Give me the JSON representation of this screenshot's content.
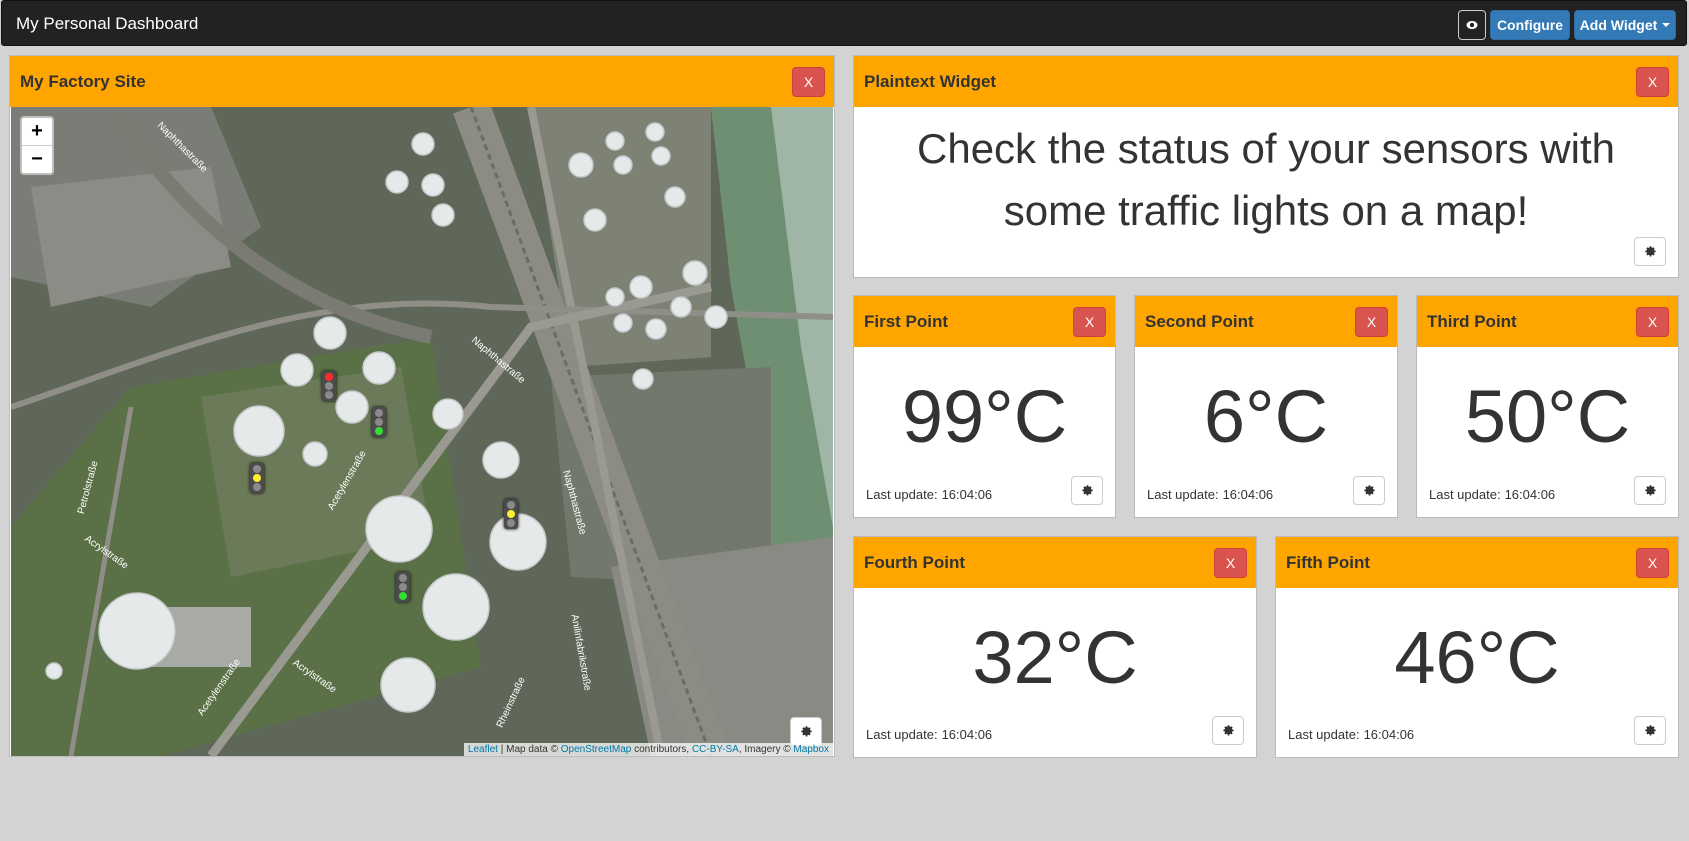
{
  "navbar": {
    "brand": "My Personal Dashboard",
    "configure_label": "Configure",
    "add_widget_label": "Add Widget"
  },
  "close_label": "X",
  "last_update_label": "Last update:",
  "map_widget": {
    "title": "My Factory Site",
    "zoom_in": "+",
    "zoom_out": "−",
    "attribution": {
      "leaflet": "Leaflet",
      "sep1": " | Map data © ",
      "osm": "OpenStreetMap",
      "sep2": " contributors, ",
      "license": "CC-BY-SA",
      "sep3": ", Imagery © ",
      "mapbox": "Mapbox"
    },
    "street_labels": [
      "Naphthastraße",
      "Naphthastraße",
      "Naphthastraße",
      "Petrolstraße",
      "Acrylstraße",
      "Acetylenstraße",
      "Acetylenstraße",
      "Acrylstraße",
      "Anilinfabrikstraße",
      "Rheinstraße"
    ],
    "traffic_lights": [
      "red",
      "green",
      "yellow",
      "yellow",
      "green"
    ]
  },
  "plaintext_widget": {
    "title": "Plaintext Widget",
    "line1": "Check the status of your sensors with",
    "line2": "some traffic lights on a map!"
  },
  "points": [
    {
      "title": "First Point",
      "value": "99°C",
      "time": "16:04:06"
    },
    {
      "title": "Second Point",
      "value": "6°C",
      "time": "16:04:06"
    },
    {
      "title": "Third Point",
      "value": "50°C",
      "time": "16:04:06"
    },
    {
      "title": "Fourth Point",
      "value": "32°C",
      "time": "16:04:06"
    },
    {
      "title": "Fifth Point",
      "value": "46°C",
      "time": "16:04:06"
    }
  ],
  "colors": {
    "header": "#ffa500",
    "close_button": "#d9534f",
    "primary_button": "#337ab7",
    "navbar": "#222222",
    "page_background": "#d3d3d3"
  },
  "icons": [
    "eye-icon",
    "gear-icon",
    "caret-down-icon",
    "traffic-light-icon"
  ]
}
